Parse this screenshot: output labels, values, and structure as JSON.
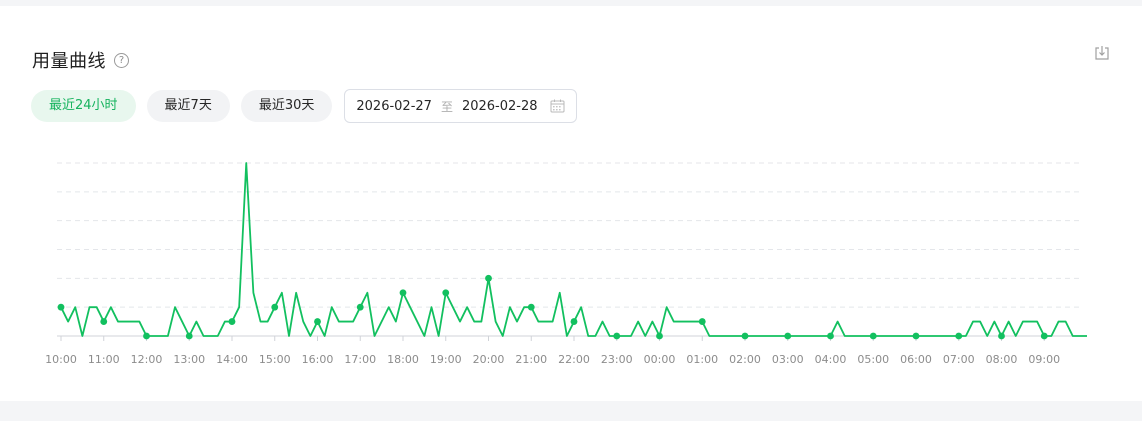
{
  "header": {
    "title": "用量曲线",
    "help_icon": "question-circle-icon",
    "export_icon": "export-icon"
  },
  "range": {
    "options": [
      "最近24小时",
      "最近7天",
      "最近30天"
    ],
    "active_index": 0,
    "start_date": "2026-02-27",
    "separator": "至",
    "end_date": "2026-02-28",
    "calendar_icon": "calendar-icon"
  },
  "colors": {
    "line": "#12c05f",
    "active_pill_bg": "#e8f7ee",
    "active_pill_text": "#16b35e",
    "grid": "#e4e6ea",
    "axis_text": "#8c8c8c"
  },
  "chart_data": {
    "type": "line",
    "y_grid_lines": 6,
    "ylim": [
      0,
      12
    ],
    "x_ticks": [
      "10:00",
      "11:00",
      "12:00",
      "13:00",
      "14:00",
      "15:00",
      "16:00",
      "17:00",
      "18:00",
      "19:00",
      "20:00",
      "21:00",
      "22:00",
      "23:00",
      "00:00",
      "01:00",
      "02:00",
      "03:00",
      "04:00",
      "05:00",
      "06:00",
      "07:00",
      "08:00",
      "09:00"
    ],
    "samples_per_hour": 6,
    "values": [
      2,
      1,
      2,
      0,
      2,
      2,
      1,
      2,
      1,
      1,
      1,
      1,
      0,
      0,
      0,
      0,
      2,
      1,
      0,
      1,
      0,
      0,
      0,
      1,
      1,
      2,
      12,
      3,
      1,
      1,
      2,
      3,
      0,
      3,
      1,
      0,
      1,
      0,
      2,
      1,
      1,
      1,
      2,
      3,
      0,
      1,
      2,
      1,
      3,
      2,
      1,
      0,
      2,
      0,
      3,
      2,
      1,
      2,
      1,
      1,
      4,
      1,
      0,
      2,
      1,
      2,
      2,
      1,
      1,
      1,
      3,
      0,
      1,
      2,
      0,
      0,
      1,
      0,
      0,
      0,
      0,
      1,
      0,
      1,
      0,
      2,
      1,
      1,
      1,
      1,
      1,
      0,
      0,
      0,
      0,
      0,
      0,
      0,
      0,
      0,
      0,
      0,
      0,
      0,
      0,
      0,
      0,
      0,
      0,
      1,
      0,
      0,
      0,
      0,
      0,
      0,
      0,
      0,
      0,
      0,
      0,
      0,
      0,
      0,
      0,
      0,
      0,
      0,
      1,
      1,
      0,
      1,
      0,
      1,
      0,
      1,
      1,
      1,
      0,
      0,
      1,
      1,
      0,
      0,
      0
    ],
    "markers": [
      0,
      6,
      12,
      18,
      24,
      30,
      36,
      42,
      48,
      54,
      60,
      66,
      72,
      78,
      84,
      90,
      96,
      102,
      108,
      114,
      120,
      126,
      132,
      138
    ]
  }
}
